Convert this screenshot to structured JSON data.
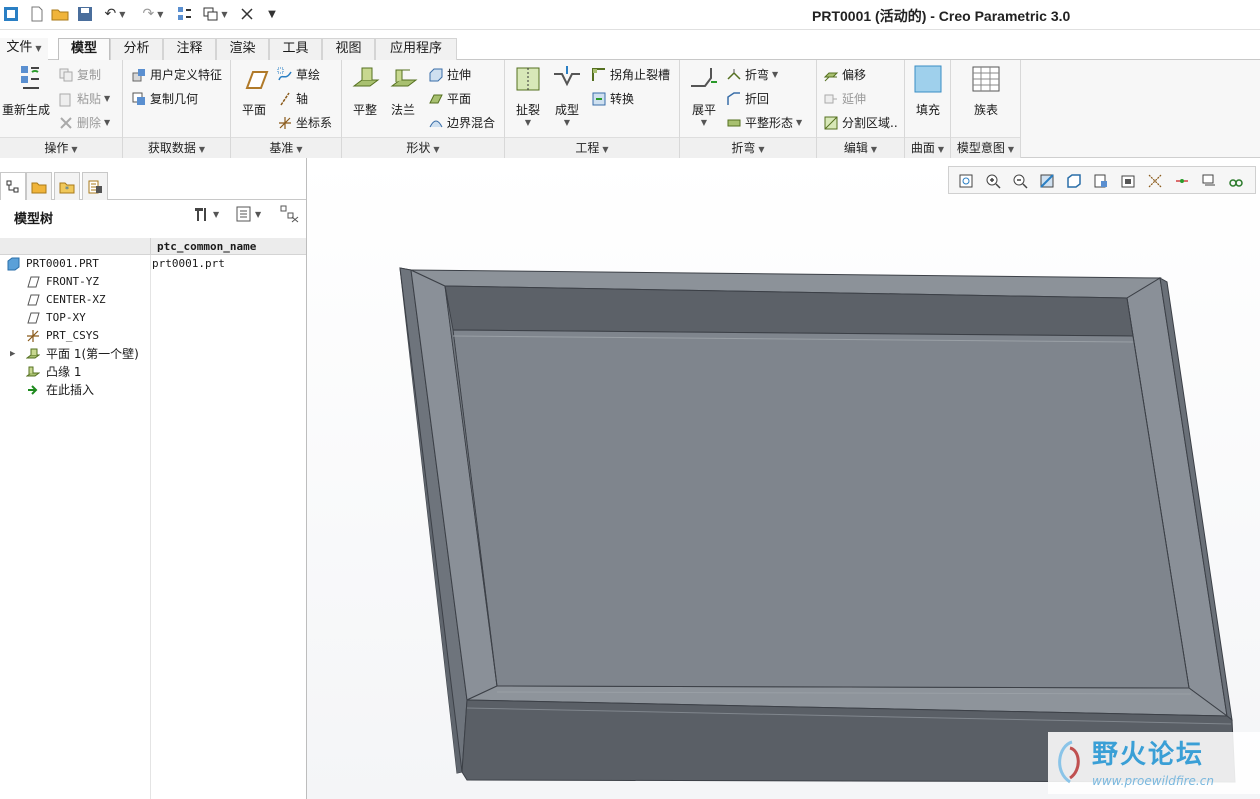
{
  "window": {
    "title": "PRT0001 (活动的) - Creo Parametric 3.0"
  },
  "tabs": [
    {
      "label": "文件"
    },
    {
      "label": "模型"
    },
    {
      "label": "分析"
    },
    {
      "label": "注释"
    },
    {
      "label": "渲染"
    },
    {
      "label": "工具"
    },
    {
      "label": "视图"
    },
    {
      "label": "应用程序"
    }
  ],
  "ribbon": {
    "operations": {
      "label": "操作",
      "regenerate": "重新生成",
      "copy": "复制",
      "paste": "粘贴",
      "delete": "删除"
    },
    "get_data": {
      "label": "获取数据",
      "udf": "用户定义特征",
      "copy_geom": "复制几何"
    },
    "datum": {
      "label": "基准",
      "plane": "平面",
      "sketch": "草绘",
      "axis": "轴",
      "csys": "坐标系"
    },
    "shapes": {
      "label": "形状",
      "flat": "平整",
      "flange": "法兰",
      "extrude": "拉伸",
      "plane": "平面",
      "blend": "边界混合"
    },
    "engineering": {
      "label": "工程",
      "rip": "扯裂",
      "form": "成型",
      "corner_relief": "拐角止裂槽",
      "convert": "转换"
    },
    "bends": {
      "label": "折弯",
      "unbend": "展平",
      "bend": "折弯",
      "bend_back": "折回",
      "flat_pattern": "平整形态"
    },
    "editing": {
      "label": "编辑",
      "offset": "偏移",
      "extend": "延伸",
      "split": "分割区域.."
    },
    "surfaces": {
      "label": "曲面",
      "fill": "填充"
    },
    "model_intent": {
      "label": "模型意图",
      "family_table": "族表"
    }
  },
  "model_tree": {
    "title": "模型树",
    "column": "ptc_common_name",
    "rows": [
      {
        "name": "PRT0001.PRT",
        "value": "prt0001.prt"
      },
      {
        "name": "FRONT-YZ"
      },
      {
        "name": "CENTER-XZ"
      },
      {
        "name": "TOP-XY"
      },
      {
        "name": "PRT_CSYS"
      },
      {
        "name": "平面 1(第一个壁)"
      },
      {
        "name": "凸缘 1"
      },
      {
        "name": "在此插入"
      }
    ]
  },
  "watermark": {
    "name": "野火论坛",
    "url": "www.proewildfire.cn"
  },
  "colors": {
    "accent": "#3a9fd6",
    "part_face": "#7f858d",
    "part_edge": "#3c4047"
  }
}
